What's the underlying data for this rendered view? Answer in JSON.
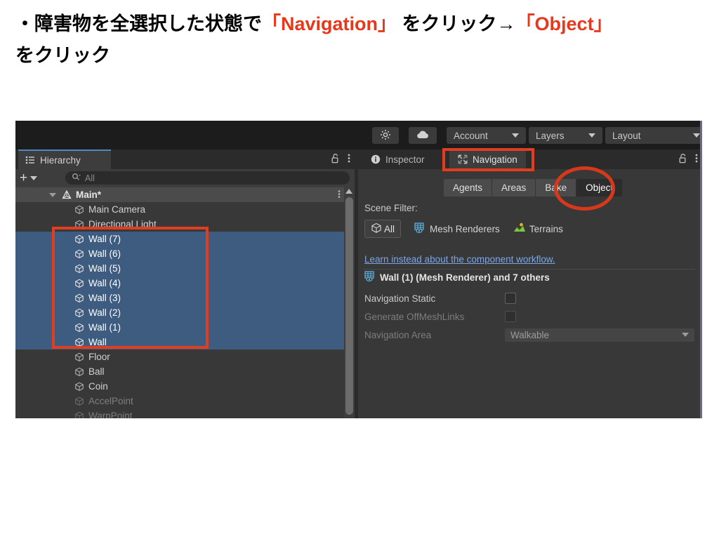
{
  "caption": {
    "line1_prefix": "・障害物を全選択した状態で",
    "line1_red1": "「Navigation」",
    "line1_mid": " をクリック→",
    "line1_red2": "「Object」",
    "line2": "をクリック",
    "red_color": "#e8381c"
  },
  "toolbar": {
    "account_label": "Account",
    "layers_label": "Layers",
    "layout_label": "Layout",
    "lighting_icon": "lighting-settings-icon",
    "cloud_icon": "cloud-icon"
  },
  "hierarchy": {
    "tab_label": "Hierarchy",
    "tab_icon": "hierarchy-icon",
    "lock_icon": "lock-open-icon",
    "kebab_icon": "kebab-menu-icon",
    "add_label": "+",
    "search_placeholder": "All",
    "search_value": "",
    "search_icon": "search-icon",
    "scene_root": "Main*",
    "scene_root_icon": "unity-scene-icon",
    "items": [
      {
        "label": "Main Camera",
        "selected": false,
        "dim": false
      },
      {
        "label": "Directional Light",
        "selected": false,
        "dim": false
      },
      {
        "label": "Wall (7)",
        "selected": true,
        "dim": false
      },
      {
        "label": "Wall (6)",
        "selected": true,
        "dim": false
      },
      {
        "label": "Wall (5)",
        "selected": true,
        "dim": false
      },
      {
        "label": "Wall (4)",
        "selected": true,
        "dim": false
      },
      {
        "label": "Wall (3)",
        "selected": true,
        "dim": false
      },
      {
        "label": "Wall (2)",
        "selected": true,
        "dim": false
      },
      {
        "label": "Wall (1)",
        "selected": true,
        "dim": false
      },
      {
        "label": "Wall",
        "selected": true,
        "dim": false
      },
      {
        "label": "Floor",
        "selected": false,
        "dim": false
      },
      {
        "label": "Ball",
        "selected": false,
        "dim": false
      },
      {
        "label": "Coin",
        "selected": false,
        "dim": false
      },
      {
        "label": "AccelPoint",
        "selected": false,
        "dim": true
      },
      {
        "label": "WarpPoint",
        "selected": false,
        "dim": true
      }
    ]
  },
  "navigation": {
    "tabs": [
      {
        "label": "Inspector",
        "icon": "info-icon",
        "active": false
      },
      {
        "label": "Navigation",
        "icon": "navigation-icon",
        "active": true
      }
    ],
    "lock_icon": "lock-open-icon",
    "kebab_icon": "kebab-menu-icon",
    "subtabs": [
      {
        "label": "Agents",
        "active": false
      },
      {
        "label": "Areas",
        "active": false
      },
      {
        "label": "Bake",
        "active": false
      },
      {
        "label": "Object",
        "active": true
      }
    ],
    "scene_filter_label": "Scene Filter:",
    "filters": [
      {
        "label": "All",
        "icon": "cube-icon",
        "active": true
      },
      {
        "label": "Mesh Renderers",
        "icon": "mesh-renderer-icon",
        "active": false
      },
      {
        "label": "Terrains",
        "icon": "terrain-icon",
        "active": false
      }
    ],
    "learn_link": "Learn instead about the component workflow.",
    "selection_summary": "Wall (1) (Mesh Renderer) and 7 others",
    "selection_icon": "mesh-renderer-icon",
    "properties": [
      {
        "label": "Navigation Static",
        "type": "checkbox",
        "checked": false,
        "disabled": false
      },
      {
        "label": "Generate OffMeshLinks",
        "type": "checkbox",
        "checked": false,
        "disabled": true
      },
      {
        "label": "Navigation Area",
        "type": "dropdown",
        "value": "Walkable",
        "disabled": true
      }
    ]
  },
  "annotations": {
    "hierarchy_box": "red-highlight-box-walls",
    "navigation_tab_box": "red-highlight-box-navigation-tab",
    "object_ellipse": "red-highlight-ellipse-object-tab",
    "color": "#e23d1e"
  }
}
